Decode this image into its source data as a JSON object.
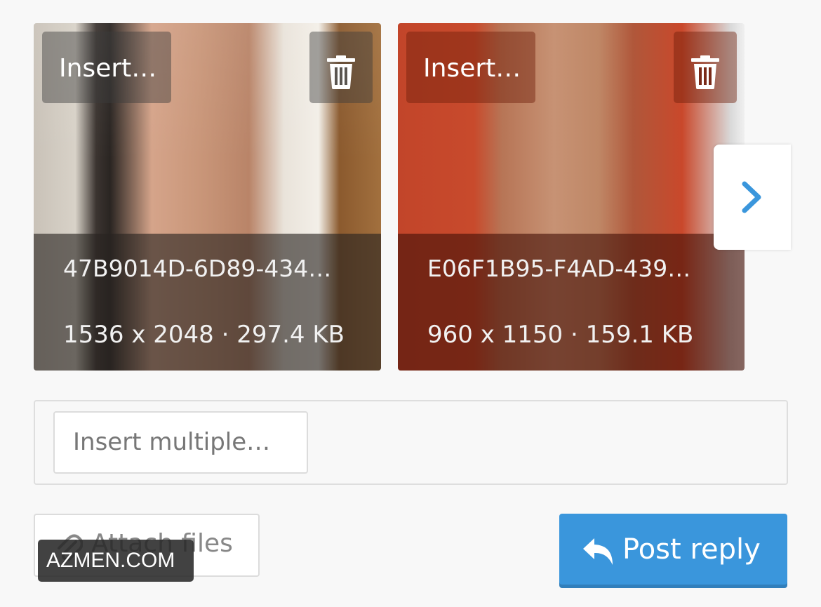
{
  "attachments": [
    {
      "insert_label": "Insert…",
      "filename": "47B9014D-6D89-434…",
      "meta": "1536 x 2048 · 297.4 KB",
      "delete_icon": "trash-icon"
    },
    {
      "insert_label": "Insert…",
      "filename": "E06F1B95-F4AD-439…",
      "meta": "960 x 1150 · 159.1 KB",
      "delete_icon": "trash-icon"
    }
  ],
  "carousel": {
    "next_icon": "chevron-right-icon"
  },
  "insert_multiple": {
    "label": "Insert multiple…"
  },
  "attach": {
    "label": "Attach files",
    "icon": "paperclip-icon"
  },
  "post": {
    "label": "Post reply",
    "icon": "reply-icon"
  },
  "watermark": {
    "text": "AZMEN.COM"
  },
  "colors": {
    "accent": "#3a96dc",
    "page_bg": "#f8f8f8",
    "chevron": "#3a96dc"
  }
}
